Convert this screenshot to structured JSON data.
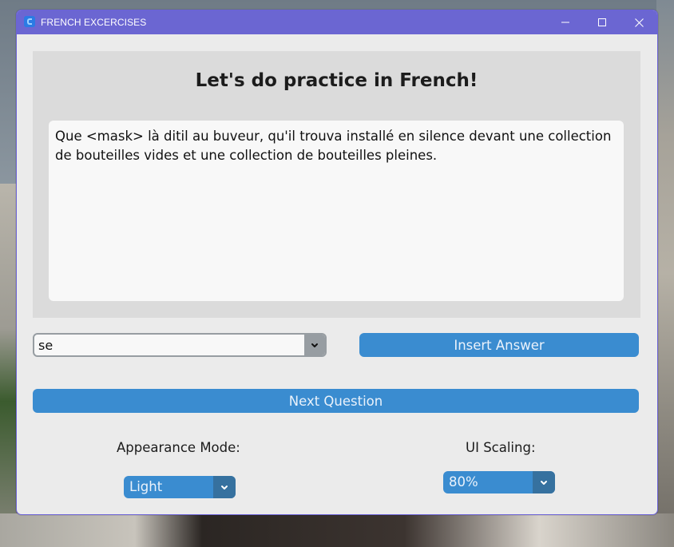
{
  "window": {
    "title": "FRENCH EXCERCISES",
    "controls": {
      "minimize": "minimize",
      "maximize": "maximize",
      "close": "close"
    }
  },
  "main": {
    "heading": "Let's do practice in French!",
    "question_text": "Que <mask> là ditil au buveur, qu'il trouva installé en silence devant une collection de bouteilles vides et une collection de bouteilles pleines."
  },
  "answer": {
    "selected_value": "se",
    "insert_button_label": "Insert Answer"
  },
  "next_button_label": "Next Question",
  "settings": {
    "appearance_label": "Appearance Mode:",
    "appearance_value": "Light",
    "scaling_label": "UI Scaling:",
    "scaling_value": "80%"
  },
  "colors": {
    "titlebar": "#6b66d2",
    "accent": "#3a8cd0",
    "accent_dark": "#36719f",
    "panel": "#dbdbdb",
    "window_bg": "#ebebeb"
  },
  "icons": {
    "app": "app-icon",
    "minimize": "minimize-icon",
    "maximize": "maximize-icon",
    "close": "close-icon",
    "dropdown": "chevron-down-icon"
  }
}
